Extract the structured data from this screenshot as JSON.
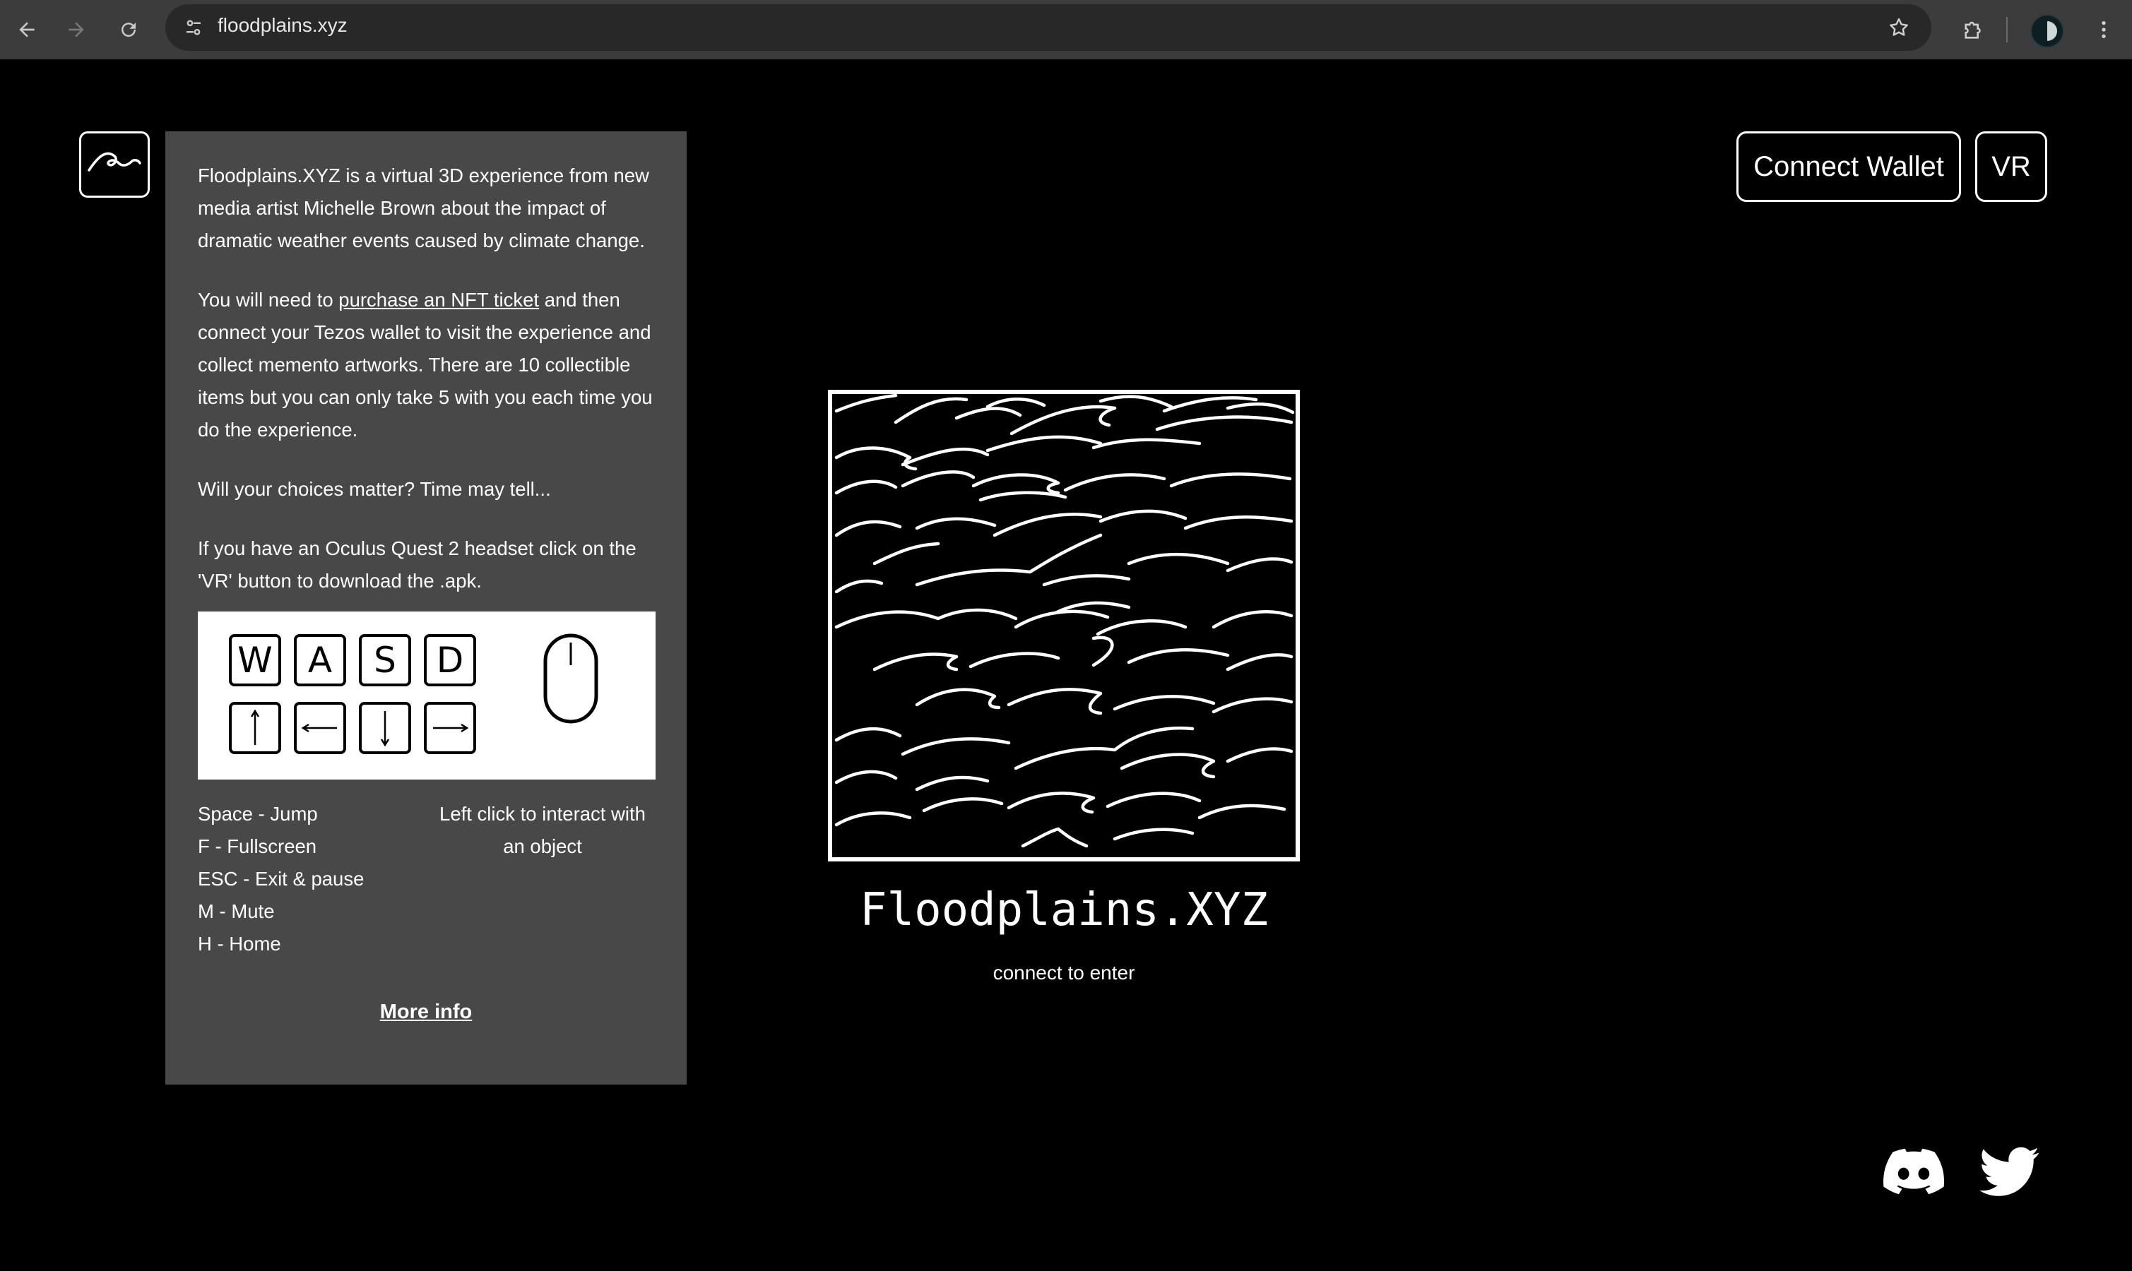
{
  "browser": {
    "url": "floodplains.xyz",
    "icons": {
      "back": "arrow-left-icon",
      "forward": "arrow-right-icon",
      "reload": "reload-icon",
      "site_info": "tune-icon",
      "bookmark": "star-icon",
      "extensions": "puzzle-icon",
      "profile": "avatar",
      "menu": "kebab-menu-icon"
    }
  },
  "header": {
    "logo_icon": "wave-logo-icon",
    "connect_wallet_label": "Connect Wallet",
    "vr_label": "VR"
  },
  "info": {
    "para1": "Floodplains.XYZ is a virtual 3D experience from new media artist Michelle Brown about the impact of dramatic weather events caused by climate change.",
    "para2_before": "You will need to ",
    "para2_link": "purchase an NFT ticket",
    "para2_after": " and then connect your Tezos wallet to visit the experience and collect memento artworks. There are 10 collectible items but you can only take 5 with you each time you do the experience.",
    "para3": "Will your choices matter? Time may tell...",
    "para4": "If you have an Oculus Quest 2 headset click on the 'VR' button to download the .apk.",
    "keys": [
      "W",
      "A",
      "S",
      "D"
    ],
    "arrow_icons": [
      "arrow-up-icon",
      "arrow-left-icon",
      "arrow-down-icon",
      "arrow-right-icon"
    ],
    "mouse_icon": "mouse-icon",
    "controls_left": [
      "Space - Jump",
      "F - Fullscreen",
      "ESC - Exit & pause",
      "M - Mute",
      "H - Home"
    ],
    "controls_right": "Left click to interact with an object",
    "more_info": "More info"
  },
  "main": {
    "artwork_icon": "waves-artwork",
    "title": "Floodplains.XYZ",
    "subtitle": "connect to enter"
  },
  "social": {
    "discord_icon": "discord-icon",
    "twitter_icon": "twitter-icon"
  },
  "colors": {
    "background": "#000000",
    "panel": "#484848",
    "chrome": "#3c3c3c",
    "omnibox": "#282828",
    "foreground": "#ffffff"
  }
}
